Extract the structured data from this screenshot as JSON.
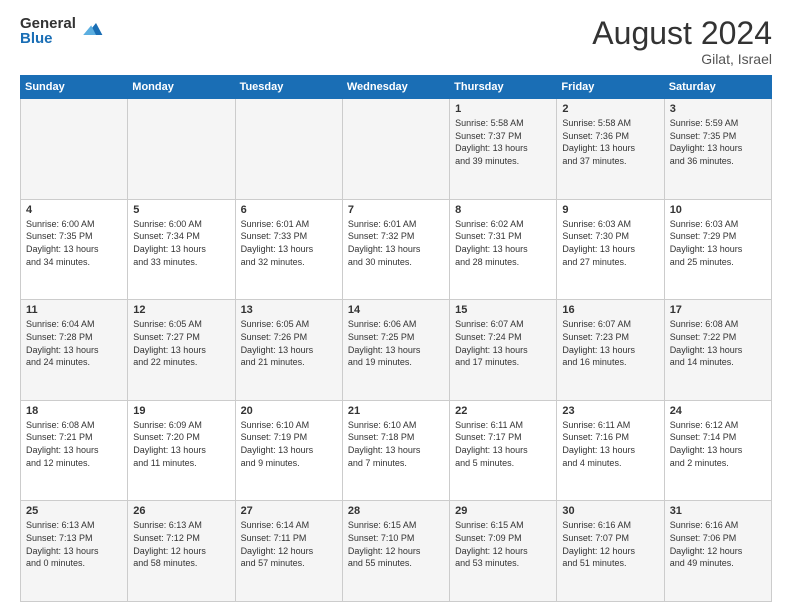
{
  "header": {
    "logo_general": "General",
    "logo_blue": "Blue",
    "month_year": "August 2024",
    "location": "Gilat, Israel"
  },
  "weekdays": [
    "Sunday",
    "Monday",
    "Tuesday",
    "Wednesday",
    "Thursday",
    "Friday",
    "Saturday"
  ],
  "weeks": [
    [
      {
        "day": "",
        "info": ""
      },
      {
        "day": "",
        "info": ""
      },
      {
        "day": "",
        "info": ""
      },
      {
        "day": "",
        "info": ""
      },
      {
        "day": "1",
        "info": "Sunrise: 5:58 AM\nSunset: 7:37 PM\nDaylight: 13 hours\nand 39 minutes."
      },
      {
        "day": "2",
        "info": "Sunrise: 5:58 AM\nSunset: 7:36 PM\nDaylight: 13 hours\nand 37 minutes."
      },
      {
        "day": "3",
        "info": "Sunrise: 5:59 AM\nSunset: 7:35 PM\nDaylight: 13 hours\nand 36 minutes."
      }
    ],
    [
      {
        "day": "4",
        "info": "Sunrise: 6:00 AM\nSunset: 7:35 PM\nDaylight: 13 hours\nand 34 minutes."
      },
      {
        "day": "5",
        "info": "Sunrise: 6:00 AM\nSunset: 7:34 PM\nDaylight: 13 hours\nand 33 minutes."
      },
      {
        "day": "6",
        "info": "Sunrise: 6:01 AM\nSunset: 7:33 PM\nDaylight: 13 hours\nand 32 minutes."
      },
      {
        "day": "7",
        "info": "Sunrise: 6:01 AM\nSunset: 7:32 PM\nDaylight: 13 hours\nand 30 minutes."
      },
      {
        "day": "8",
        "info": "Sunrise: 6:02 AM\nSunset: 7:31 PM\nDaylight: 13 hours\nand 28 minutes."
      },
      {
        "day": "9",
        "info": "Sunrise: 6:03 AM\nSunset: 7:30 PM\nDaylight: 13 hours\nand 27 minutes."
      },
      {
        "day": "10",
        "info": "Sunrise: 6:03 AM\nSunset: 7:29 PM\nDaylight: 13 hours\nand 25 minutes."
      }
    ],
    [
      {
        "day": "11",
        "info": "Sunrise: 6:04 AM\nSunset: 7:28 PM\nDaylight: 13 hours\nand 24 minutes."
      },
      {
        "day": "12",
        "info": "Sunrise: 6:05 AM\nSunset: 7:27 PM\nDaylight: 13 hours\nand 22 minutes."
      },
      {
        "day": "13",
        "info": "Sunrise: 6:05 AM\nSunset: 7:26 PM\nDaylight: 13 hours\nand 21 minutes."
      },
      {
        "day": "14",
        "info": "Sunrise: 6:06 AM\nSunset: 7:25 PM\nDaylight: 13 hours\nand 19 minutes."
      },
      {
        "day": "15",
        "info": "Sunrise: 6:07 AM\nSunset: 7:24 PM\nDaylight: 13 hours\nand 17 minutes."
      },
      {
        "day": "16",
        "info": "Sunrise: 6:07 AM\nSunset: 7:23 PM\nDaylight: 13 hours\nand 16 minutes."
      },
      {
        "day": "17",
        "info": "Sunrise: 6:08 AM\nSunset: 7:22 PM\nDaylight: 13 hours\nand 14 minutes."
      }
    ],
    [
      {
        "day": "18",
        "info": "Sunrise: 6:08 AM\nSunset: 7:21 PM\nDaylight: 13 hours\nand 12 minutes."
      },
      {
        "day": "19",
        "info": "Sunrise: 6:09 AM\nSunset: 7:20 PM\nDaylight: 13 hours\nand 11 minutes."
      },
      {
        "day": "20",
        "info": "Sunrise: 6:10 AM\nSunset: 7:19 PM\nDaylight: 13 hours\nand 9 minutes."
      },
      {
        "day": "21",
        "info": "Sunrise: 6:10 AM\nSunset: 7:18 PM\nDaylight: 13 hours\nand 7 minutes."
      },
      {
        "day": "22",
        "info": "Sunrise: 6:11 AM\nSunset: 7:17 PM\nDaylight: 13 hours\nand 5 minutes."
      },
      {
        "day": "23",
        "info": "Sunrise: 6:11 AM\nSunset: 7:16 PM\nDaylight: 13 hours\nand 4 minutes."
      },
      {
        "day": "24",
        "info": "Sunrise: 6:12 AM\nSunset: 7:14 PM\nDaylight: 13 hours\nand 2 minutes."
      }
    ],
    [
      {
        "day": "25",
        "info": "Sunrise: 6:13 AM\nSunset: 7:13 PM\nDaylight: 13 hours\nand 0 minutes."
      },
      {
        "day": "26",
        "info": "Sunrise: 6:13 AM\nSunset: 7:12 PM\nDaylight: 12 hours\nand 58 minutes."
      },
      {
        "day": "27",
        "info": "Sunrise: 6:14 AM\nSunset: 7:11 PM\nDaylight: 12 hours\nand 57 minutes."
      },
      {
        "day": "28",
        "info": "Sunrise: 6:15 AM\nSunset: 7:10 PM\nDaylight: 12 hours\nand 55 minutes."
      },
      {
        "day": "29",
        "info": "Sunrise: 6:15 AM\nSunset: 7:09 PM\nDaylight: 12 hours\nand 53 minutes."
      },
      {
        "day": "30",
        "info": "Sunrise: 6:16 AM\nSunset: 7:07 PM\nDaylight: 12 hours\nand 51 minutes."
      },
      {
        "day": "31",
        "info": "Sunrise: 6:16 AM\nSunset: 7:06 PM\nDaylight: 12 hours\nand 49 minutes."
      }
    ]
  ]
}
